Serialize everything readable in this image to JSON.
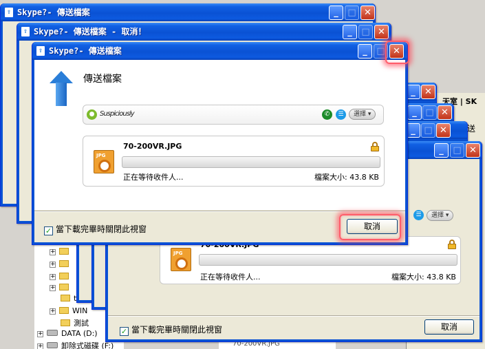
{
  "back_windows": [
    {
      "title": "Skype?- 傳送檔案"
    },
    {
      "title": "Skype?- 傳送檔案 - 取消！"
    }
  ],
  "main_dialog": {
    "title": "Skype?- 傳送檔案",
    "heading": "傳送檔案",
    "contact_name": "Suspiciously",
    "select_label": "選擇",
    "file": {
      "name": "70-200VR.JPG",
      "status": "正在等待收件人...",
      "size": "檔案大小: 43.8 KB",
      "progress": 0
    },
    "checkbox_label": "當下載完畢時關閉此視窗",
    "checkbox_checked": true,
    "cancel_label": "取消"
  },
  "front_dialog": {
    "select_label": "選擇",
    "file": {
      "name": "70-200VR.JPG",
      "status": "正在等待收件人...",
      "size": "檔案大小: 43.8 KB",
      "progress": 0
    },
    "checkbox_label": "當下載完畢時關閉此視窗",
    "checkbox_checked": true,
    "cancel_label": "取消"
  },
  "bg_right": {
    "title_fragment": "天室 | SK",
    "side_char": "送"
  },
  "tree": {
    "folder_t": "t",
    "folder_win": "WIN",
    "folder_test": "測試",
    "drive_data": "DATA (D:)",
    "drive_removable": "卸除式磁碟 (F:)",
    "file_fragment": "70-200VR.JPG"
  },
  "colors": {
    "xp_title_blue": "#0a52d4",
    "dialog_face": "#ece9d8",
    "highlight_red": "#ff5d6a"
  }
}
